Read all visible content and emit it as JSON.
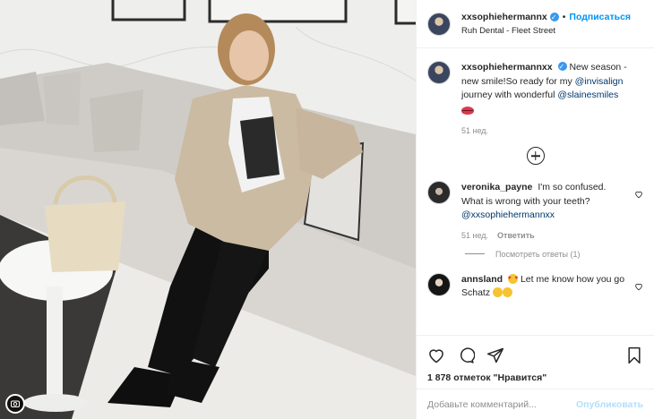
{
  "header": {
    "username": "xxsophiehermannx",
    "separator": "•",
    "follow_label": "Подписаться",
    "location": "Ruh Dental - Fleet Street"
  },
  "caption": {
    "username": "xxsophiehermannxx",
    "text_1": "New season - new smile!So ready for my ",
    "mention_1": "@invisalign",
    "text_2": " journey with wonderful ",
    "mention_2": "@slainesmiles",
    "emoji": "lips-emoji",
    "time": "51 нед."
  },
  "comments": [
    {
      "username": "veronika_payne",
      "text": "I'm so confused. What is wrong with your teeth?",
      "mention": "@xxsophiehermannxx",
      "time": "51 нед.",
      "reply_label": "Ответить"
    },
    {
      "username": "annsland",
      "text_1": "Let me know how you go Schatz",
      "emoji": "heart-eyes-emoji"
    }
  ],
  "view_replies_label": "Посмотреть ответы (1)",
  "likes_text": "1 878 отметок \"Нравится\"",
  "comment_input": {
    "placeholder": "Добавьте комментарий...",
    "value": ""
  },
  "publish_label": "Опубликовать",
  "icons": [
    "heart-icon",
    "comment-icon",
    "share-icon",
    "save-icon",
    "plus-icon",
    "camera-badge-icon"
  ],
  "colors": {
    "link": "#0095f6",
    "mention": "#00376b",
    "muted": "#8e8e8e",
    "publish_disabled": "#b2dffc"
  }
}
